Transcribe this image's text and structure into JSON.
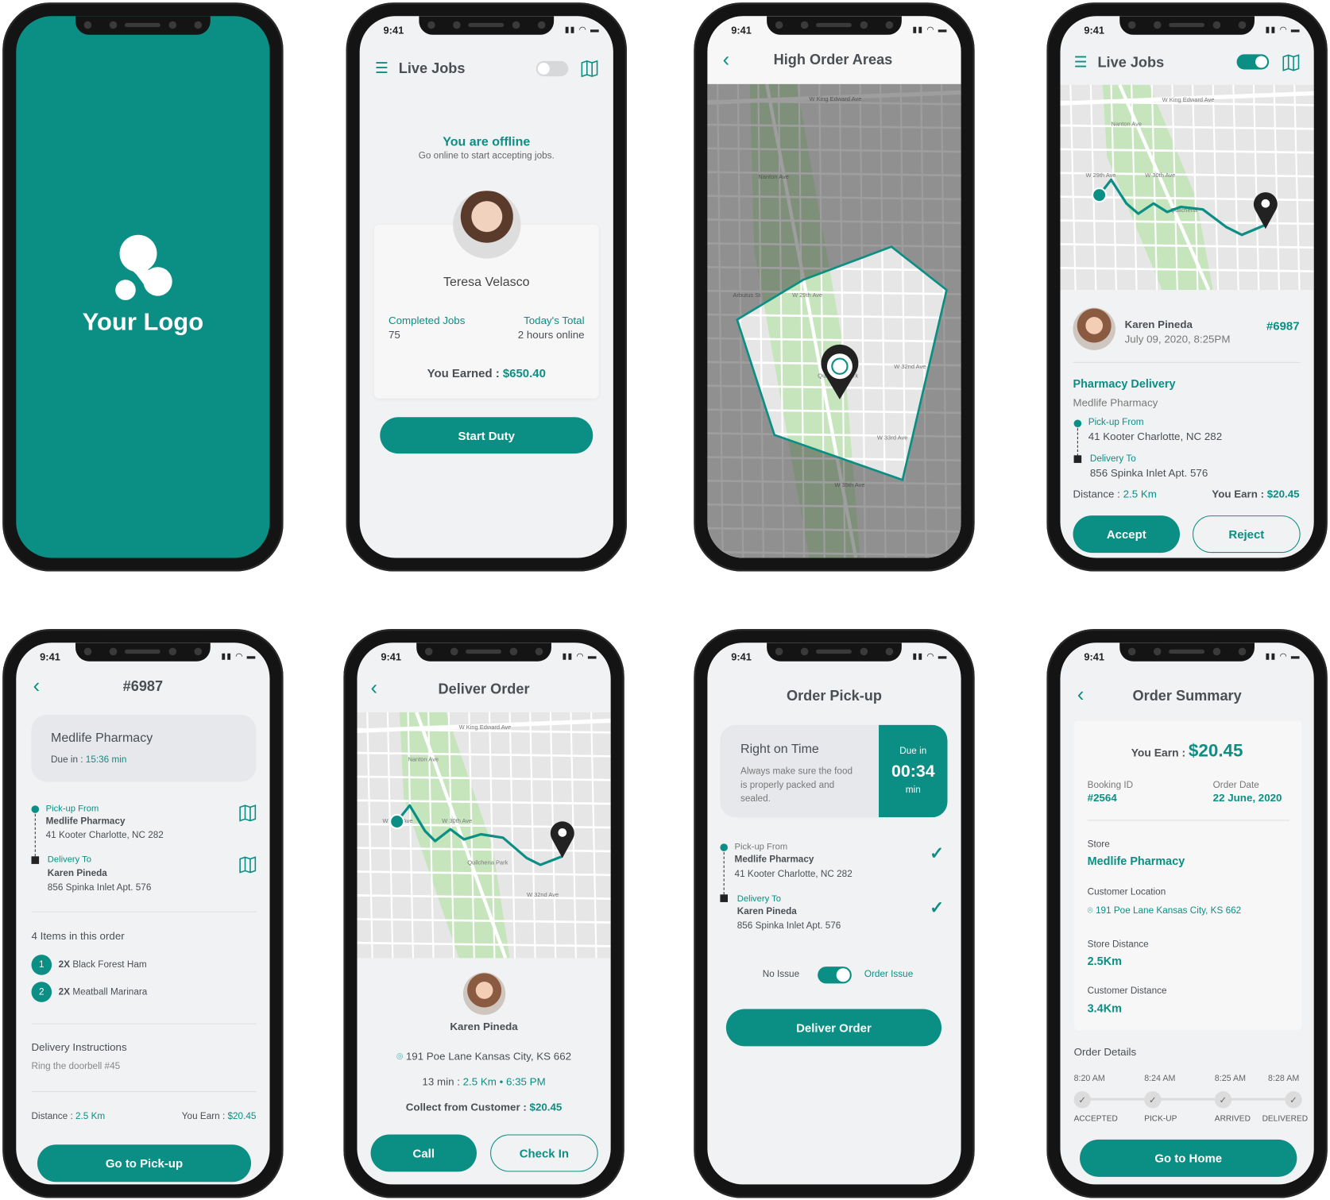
{
  "brand": {
    "accent": "#0b8f84",
    "screen_bg": "#f1f2f3"
  },
  "status_time": "9:41",
  "splash": {
    "logo_text": "Your Logo",
    "background": "#0b8f84"
  },
  "offline": {
    "title": "Live Jobs",
    "online_toggle": false,
    "offline_title": "You are offline",
    "offline_sub": "Go online to start accepting jobs.",
    "driver_name": "Teresa Velasco",
    "completed_label": "Completed Jobs",
    "completed_value": "75",
    "today_label": "Today's Total",
    "today_value": "2 hours online",
    "earned_label": "You Earned : ",
    "earned_value": "$650.40",
    "start_button": "Start Duty"
  },
  "areas": {
    "title": "High Order Areas",
    "map_labels": [
      "W King Edward Ave",
      "Nanton Ave",
      "Arbutus St",
      "W 29th Ave",
      "Quilchena Park",
      "W 33rd Ave",
      "W 32nd Ave",
      "W 35th Ave"
    ]
  },
  "live_job": {
    "title": "Live Jobs",
    "online_toggle": true,
    "customer": "Karen Pineda",
    "datetime": "July 09, 2020, 8:25PM",
    "order_id": "#6987",
    "job_type": "Pharmacy Delivery",
    "store": "Medlife Pharmacy",
    "pickup_label": "Pick-up From",
    "pickup_address": "41 Kooter Charlotte, NC 282",
    "delivery_label": "Delivery To",
    "delivery_address": "856 Spinka Inlet Apt. 576",
    "distance_label": "Distance : ",
    "distance_value": "2.5 Km",
    "earn_label": "You Earn : ",
    "earn_value": "$20.45",
    "accept": "Accept",
    "reject": "Reject",
    "map_labels": [
      "W King Edward Ave",
      "Nanton Ave",
      "W 29th Ave",
      "W 30th Ave",
      "Quilchena"
    ]
  },
  "order_detail": {
    "title": "#6987",
    "store": "Medlife Pharmacy",
    "due_label": "Due in : ",
    "due_value": "15:36 min",
    "pickup_label": "Pick-up From",
    "pickup_name": "Medlife Pharmacy",
    "pickup_address": "41 Kooter Charlotte, NC 282",
    "delivery_label": "Delivery To",
    "delivery_name": "Karen Pineda",
    "delivery_address": "856 Spinka Inlet Apt. 576",
    "items_title": "4 Items in this order",
    "items": [
      {
        "n": "1",
        "qty": "2X",
        "name": "Black Forest Ham"
      },
      {
        "n": "2",
        "qty": "2X",
        "name": "Meatball Marinara"
      }
    ],
    "instructions_title": "Delivery Instructions",
    "instructions": "Ring the doorbell #45",
    "distance_label": "Distance : ",
    "distance_value": "2.5 Km",
    "earn_label": "You Earn : ",
    "earn_value": "$20.45",
    "button": "Go to Pick-up"
  },
  "deliver": {
    "title": "Deliver Order",
    "customer": "Karen Pineda",
    "address": "191 Poe Lane Kansas City, KS 662",
    "eta_label": "13 min : ",
    "eta_distance": "2.5 Km",
    "eta_time": "6:35 PM",
    "collect_label": "Collect from Customer : ",
    "collect_value": "$20.45",
    "call": "Call",
    "check_in": "Check In",
    "map_labels": [
      "W King Edward Ave",
      "Nanton Ave",
      "W 29th Ave",
      "W 30th Ave",
      "Quilchena Park",
      "W 32nd Ave"
    ]
  },
  "pickup": {
    "title": "Order Pick-up",
    "card_title": "Right on Time",
    "card_desc": [
      "Always make sure the food",
      "is properly packed and",
      "sealed."
    ],
    "due_label": "Due in",
    "due_value": "00:34",
    "due_unit": "min",
    "pickup_label": "Pick-up From",
    "pickup_name": "Medlife Pharmacy",
    "pickup_address": "41 Kooter Charlotte, NC 282",
    "delivery_label": "Delivery To",
    "delivery_name": "Karen Pineda",
    "delivery_address": "856 Spinka Inlet Apt. 576",
    "no_issue": "No Issue",
    "order_issue": "Order Issue",
    "issue_toggle": true,
    "button": "Deliver Order"
  },
  "summary": {
    "title": "Order Summary",
    "earn_label": "You Earn : ",
    "earn_value": "$20.45",
    "booking_label": "Booking ID",
    "booking_value": "#2564",
    "date_label": "Order Date",
    "date_value": "22 June, 2020",
    "store_label": "Store",
    "store_value": "Medlife Pharmacy",
    "location_label": "Customer Location",
    "location_value": "191 Poe Lane Kansas City, KS 662",
    "store_dist_label": "Store Distance",
    "store_dist_value": "2.5Km",
    "cust_dist_label": "Customer Distance",
    "cust_dist_value": "3.4Km",
    "details_title": "Order Details",
    "steps": [
      {
        "time": "8:20 AM",
        "label": "ACCEPTED"
      },
      {
        "time": "8:24 AM",
        "label": "PICK-UP"
      },
      {
        "time": "8:25 AM",
        "label": "ARRIVED"
      },
      {
        "time": "8:28 AM",
        "label": "DELIVERED"
      }
    ],
    "button": "Go to Home"
  }
}
